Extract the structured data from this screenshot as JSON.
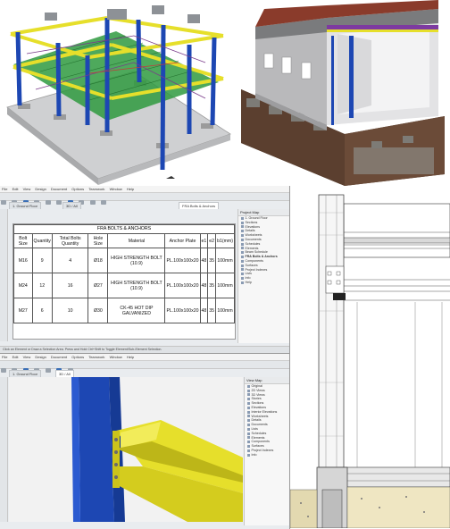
{
  "app_top": {
    "menu": [
      "File",
      "Edit",
      "View",
      "Design",
      "Document",
      "Options",
      "Teamwork",
      "Window",
      "Help"
    ],
    "tabs": [
      "1. Ground Floor",
      "3D / All",
      "FRA Bolts & Anchors"
    ],
    "status": "Click an Element or Draw a Selection Area. Press and Hold Ctrl+Shift to Toggle Element/Sub-Element Selection."
  },
  "bolt_table": {
    "title": "FRA BOLTS & ANCHORS",
    "columns": [
      "Bolt Size",
      "Quantity",
      "Total Bolts Quantity",
      "Hole Size",
      "Material",
      "Anchor Plate",
      "e1",
      "e2",
      "b1(mm)"
    ],
    "rows": [
      [
        "M16",
        "9",
        "4",
        "Ø18",
        "HIGH STRENGTH BOLT (10.9)",
        "PL.100x100x20",
        "48",
        "35",
        "100mm"
      ],
      [
        "M24",
        "12",
        "16",
        "Ø27",
        "HIGH STRENGTH BOLT (10.9)",
        "PL.100x100x20",
        "48",
        "35",
        "100mm"
      ],
      [
        "M27",
        "6",
        "10",
        "Ø30",
        "CK-45 HOT DIP GALVANIZED",
        "PL.100x100x20",
        "48",
        "35",
        "100mm"
      ]
    ]
  },
  "app_bottom": {
    "menu": [
      "File",
      "Edit",
      "View",
      "Design",
      "Document",
      "Options",
      "Teamwork",
      "Window",
      "Help"
    ],
    "tabs": [
      "1. Ground Floor",
      "3D / All"
    ]
  },
  "navigator_top": [
    "Project Map",
    "1. Ground Floor",
    "Sections",
    "Elevations",
    "Details",
    "Worksheets",
    "Documents",
    "Schedules",
    "Elements",
    "Beam Schedule",
    "FRA Bolts & Anchors",
    "Components",
    "Surfaces",
    "Project Indexes",
    "Lists",
    "Info",
    "Help"
  ],
  "navigator_bottom": [
    "View Map",
    "Original",
    "2D Views",
    "3D Views",
    "Stories",
    "Sections",
    "Elevations",
    "Interior Elevations",
    "Worksheets",
    "Details",
    "Documents",
    "Lists",
    "Schedules",
    "Elements",
    "Components",
    "Surfaces",
    "Project Indexes",
    "Info"
  ],
  "colors": {
    "steel_blue": "#1d47b3",
    "steel_yellow": "#e6df2b",
    "floor_green": "#2d8c3a",
    "concrete": "#c9c9c9",
    "brick_red": "#8a3b2b"
  }
}
